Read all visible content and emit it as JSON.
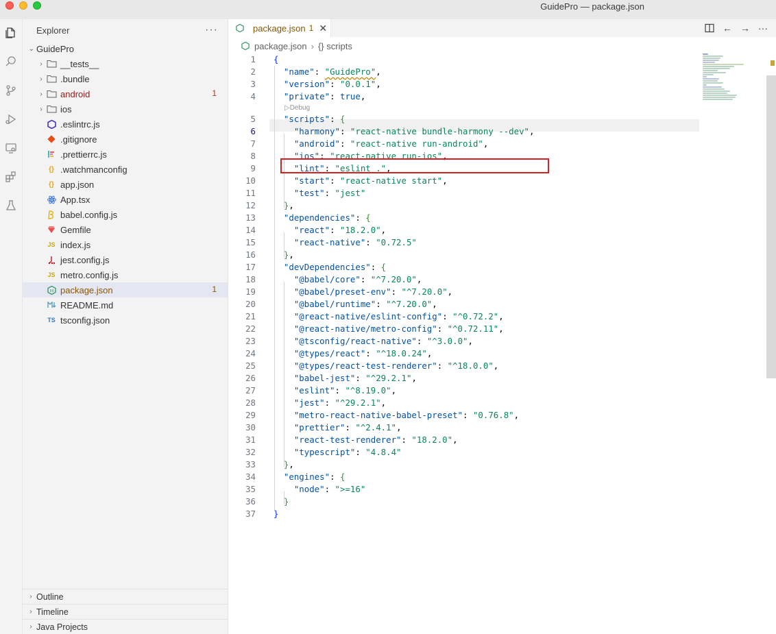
{
  "window": {
    "title": "GuidePro — package.json"
  },
  "activity_icons": [
    "files-icon",
    "search-icon",
    "source-control-icon",
    "run-debug-icon",
    "remote-explorer-icon",
    "extensions-icon",
    "testing-icon"
  ],
  "sidebar": {
    "title": "Explorer",
    "more": "···",
    "root": "GuidePro",
    "items": [
      {
        "label": "__tests__",
        "type": "folder",
        "icon": "folder-icon"
      },
      {
        "label": ".bundle",
        "type": "folder",
        "icon": "folder-icon"
      },
      {
        "label": "android",
        "type": "folder",
        "icon": "folder-icon",
        "badge": "1",
        "status": "error"
      },
      {
        "label": "ios",
        "type": "folder",
        "icon": "folder-icon"
      },
      {
        "label": ".eslintrc.js",
        "type": "file",
        "icon": "eslint-icon"
      },
      {
        "label": ".gitignore",
        "type": "file",
        "icon": "git-icon"
      },
      {
        "label": ".prettierrc.js",
        "type": "file",
        "icon": "prettier-icon"
      },
      {
        "label": ".watchmanconfig",
        "type": "file",
        "icon": "json-braces-icon"
      },
      {
        "label": "app.json",
        "type": "file",
        "icon": "json-braces-icon"
      },
      {
        "label": "App.tsx",
        "type": "file",
        "icon": "react-icon"
      },
      {
        "label": "babel.config.js",
        "type": "file",
        "icon": "babel-icon"
      },
      {
        "label": "Gemfile",
        "type": "file",
        "icon": "ruby-icon"
      },
      {
        "label": "index.js",
        "type": "file",
        "icon": "js-icon"
      },
      {
        "label": "jest.config.js",
        "type": "file",
        "icon": "jest-icon"
      },
      {
        "label": "metro.config.js",
        "type": "file",
        "icon": "js-icon"
      },
      {
        "label": "package.json",
        "type": "file",
        "icon": "nodejs-icon",
        "badge": "1",
        "status": "warning",
        "selected": true
      },
      {
        "label": "README.md",
        "type": "file",
        "icon": "markdown-icon"
      },
      {
        "label": "tsconfig.json",
        "type": "file",
        "icon": "tsconfig-icon"
      }
    ],
    "panels": [
      "Outline",
      "Timeline",
      "Java Projects"
    ]
  },
  "tab": {
    "name": "package.json",
    "count": "1",
    "close": "✕"
  },
  "breadcrumb": {
    "file": "package.json",
    "symbol": "{} scripts"
  },
  "codelens": "▷Debug",
  "colors": {
    "key": "#0451a5",
    "string": "#098658",
    "error": "#a31515",
    "warning": "#895503",
    "highlight_box": "#d42020"
  }
}
